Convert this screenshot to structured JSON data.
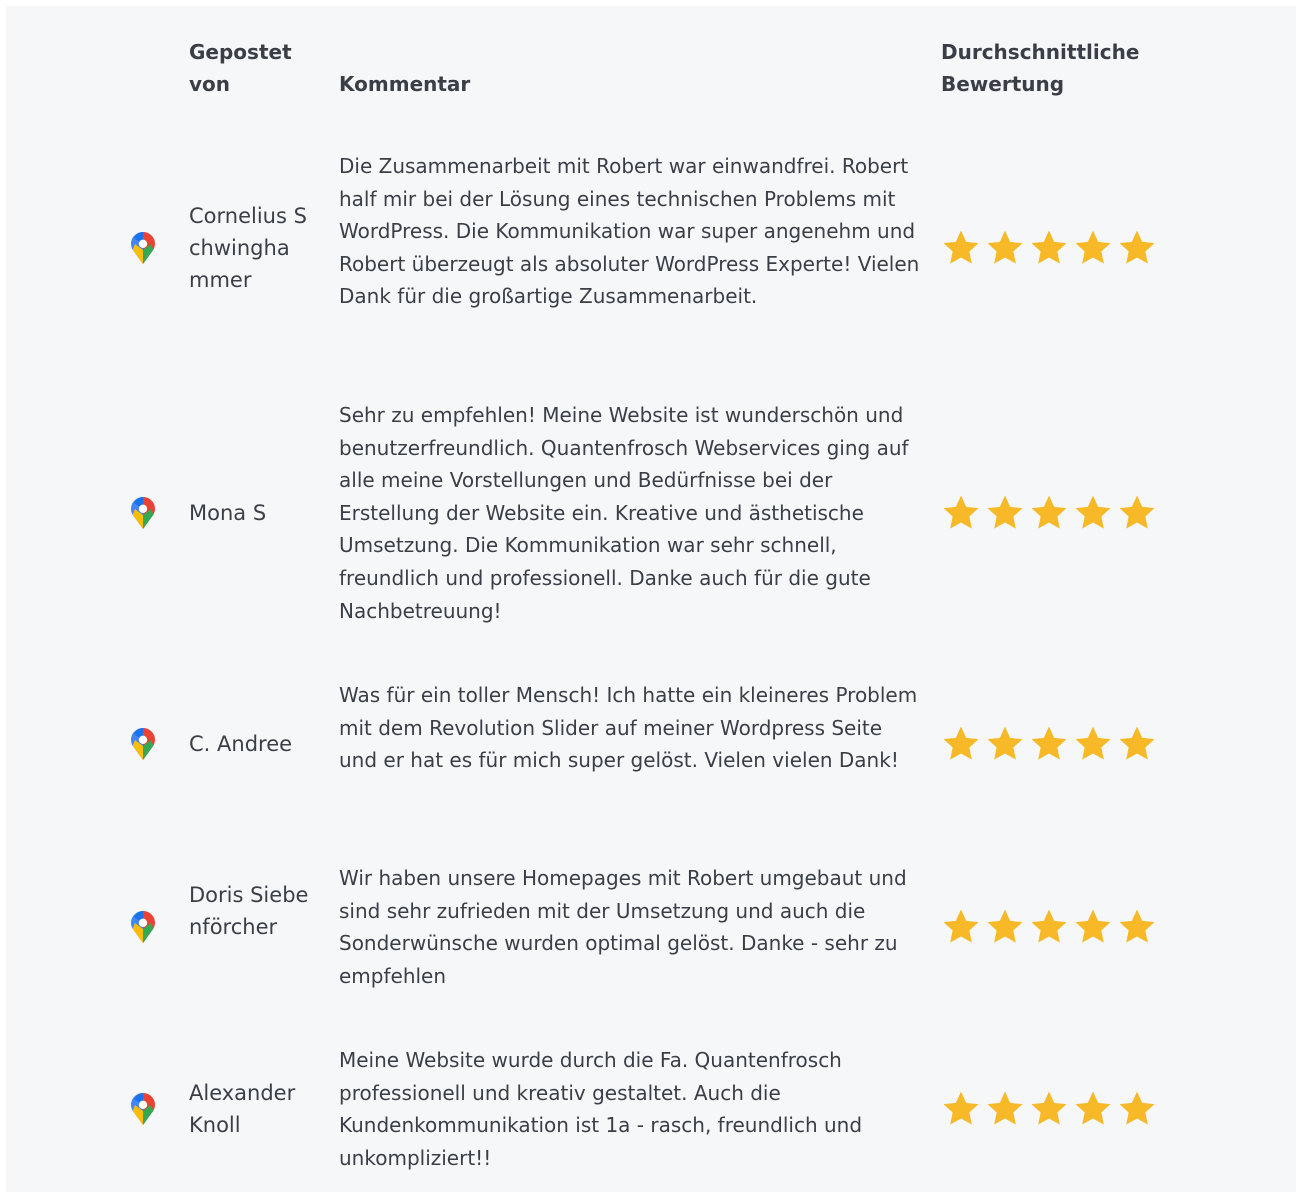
{
  "table": {
    "headers": {
      "posted_by": "Gepostet von",
      "comment": "Kommentar",
      "rating": "Durchschnittliche Bewertung"
    },
    "star_color": "#f7b928",
    "reviews": [
      {
        "author": "Cornelius Schwinghammer",
        "comment": "Die Zusammenarbeit mit Robert war einwandfrei. Robert half mir bei der Lösung eines technischen Problems mit WordPress. Die Kommunikation war super angenehm und Robert überzeugt als absoluter WordPress Experte! Vielen Dank für die großartige Zusammenarbeit.",
        "rating": 5,
        "source_icon": "google-maps-pin-icon"
      },
      {
        "author": "Mona S",
        "comment": "Sehr zu empfehlen! Meine Website ist wunderschön und benutzerfreundlich. Quantenfrosch Webservices ging auf alle meine Vorstellungen und Bedürfnisse bei der Erstellung der Website ein. Kreative und ästhetische Umsetzung. Die Kommunikation war sehr schnell, freundlich und professionell. Danke auch für die gute Nachbetreuung!",
        "rating": 5,
        "source_icon": "google-maps-pin-icon"
      },
      {
        "author": "C. Andree",
        "comment": "Was für ein toller Mensch! Ich hatte ein kleineres Problem mit dem Revolution Slider auf meiner Wordpress Seite und er hat es für mich super gelöst. Vielen vielen Dank!",
        "rating": 5,
        "source_icon": "google-maps-pin-icon"
      },
      {
        "author": "Doris Siebenförcher",
        "comment": "Wir haben unsere Homepages mit Robert umgebaut und sind sehr zufrieden mit der Umsetzung und auch die Sonderwünsche wurden optimal gelöst. Danke - sehr zu empfehlen",
        "rating": 5,
        "source_icon": "google-maps-pin-icon"
      },
      {
        "author": "Alexander Knoll",
        "comment": "Meine Website wurde durch die Fa. Quantenfrosch professionell und kreativ gestaltet. Auch die Kundenkommunikation ist 1a - rasch, freundlich und unkompliziert!!",
        "rating": 5,
        "source_icon": "google-maps-pin-icon"
      }
    ]
  }
}
